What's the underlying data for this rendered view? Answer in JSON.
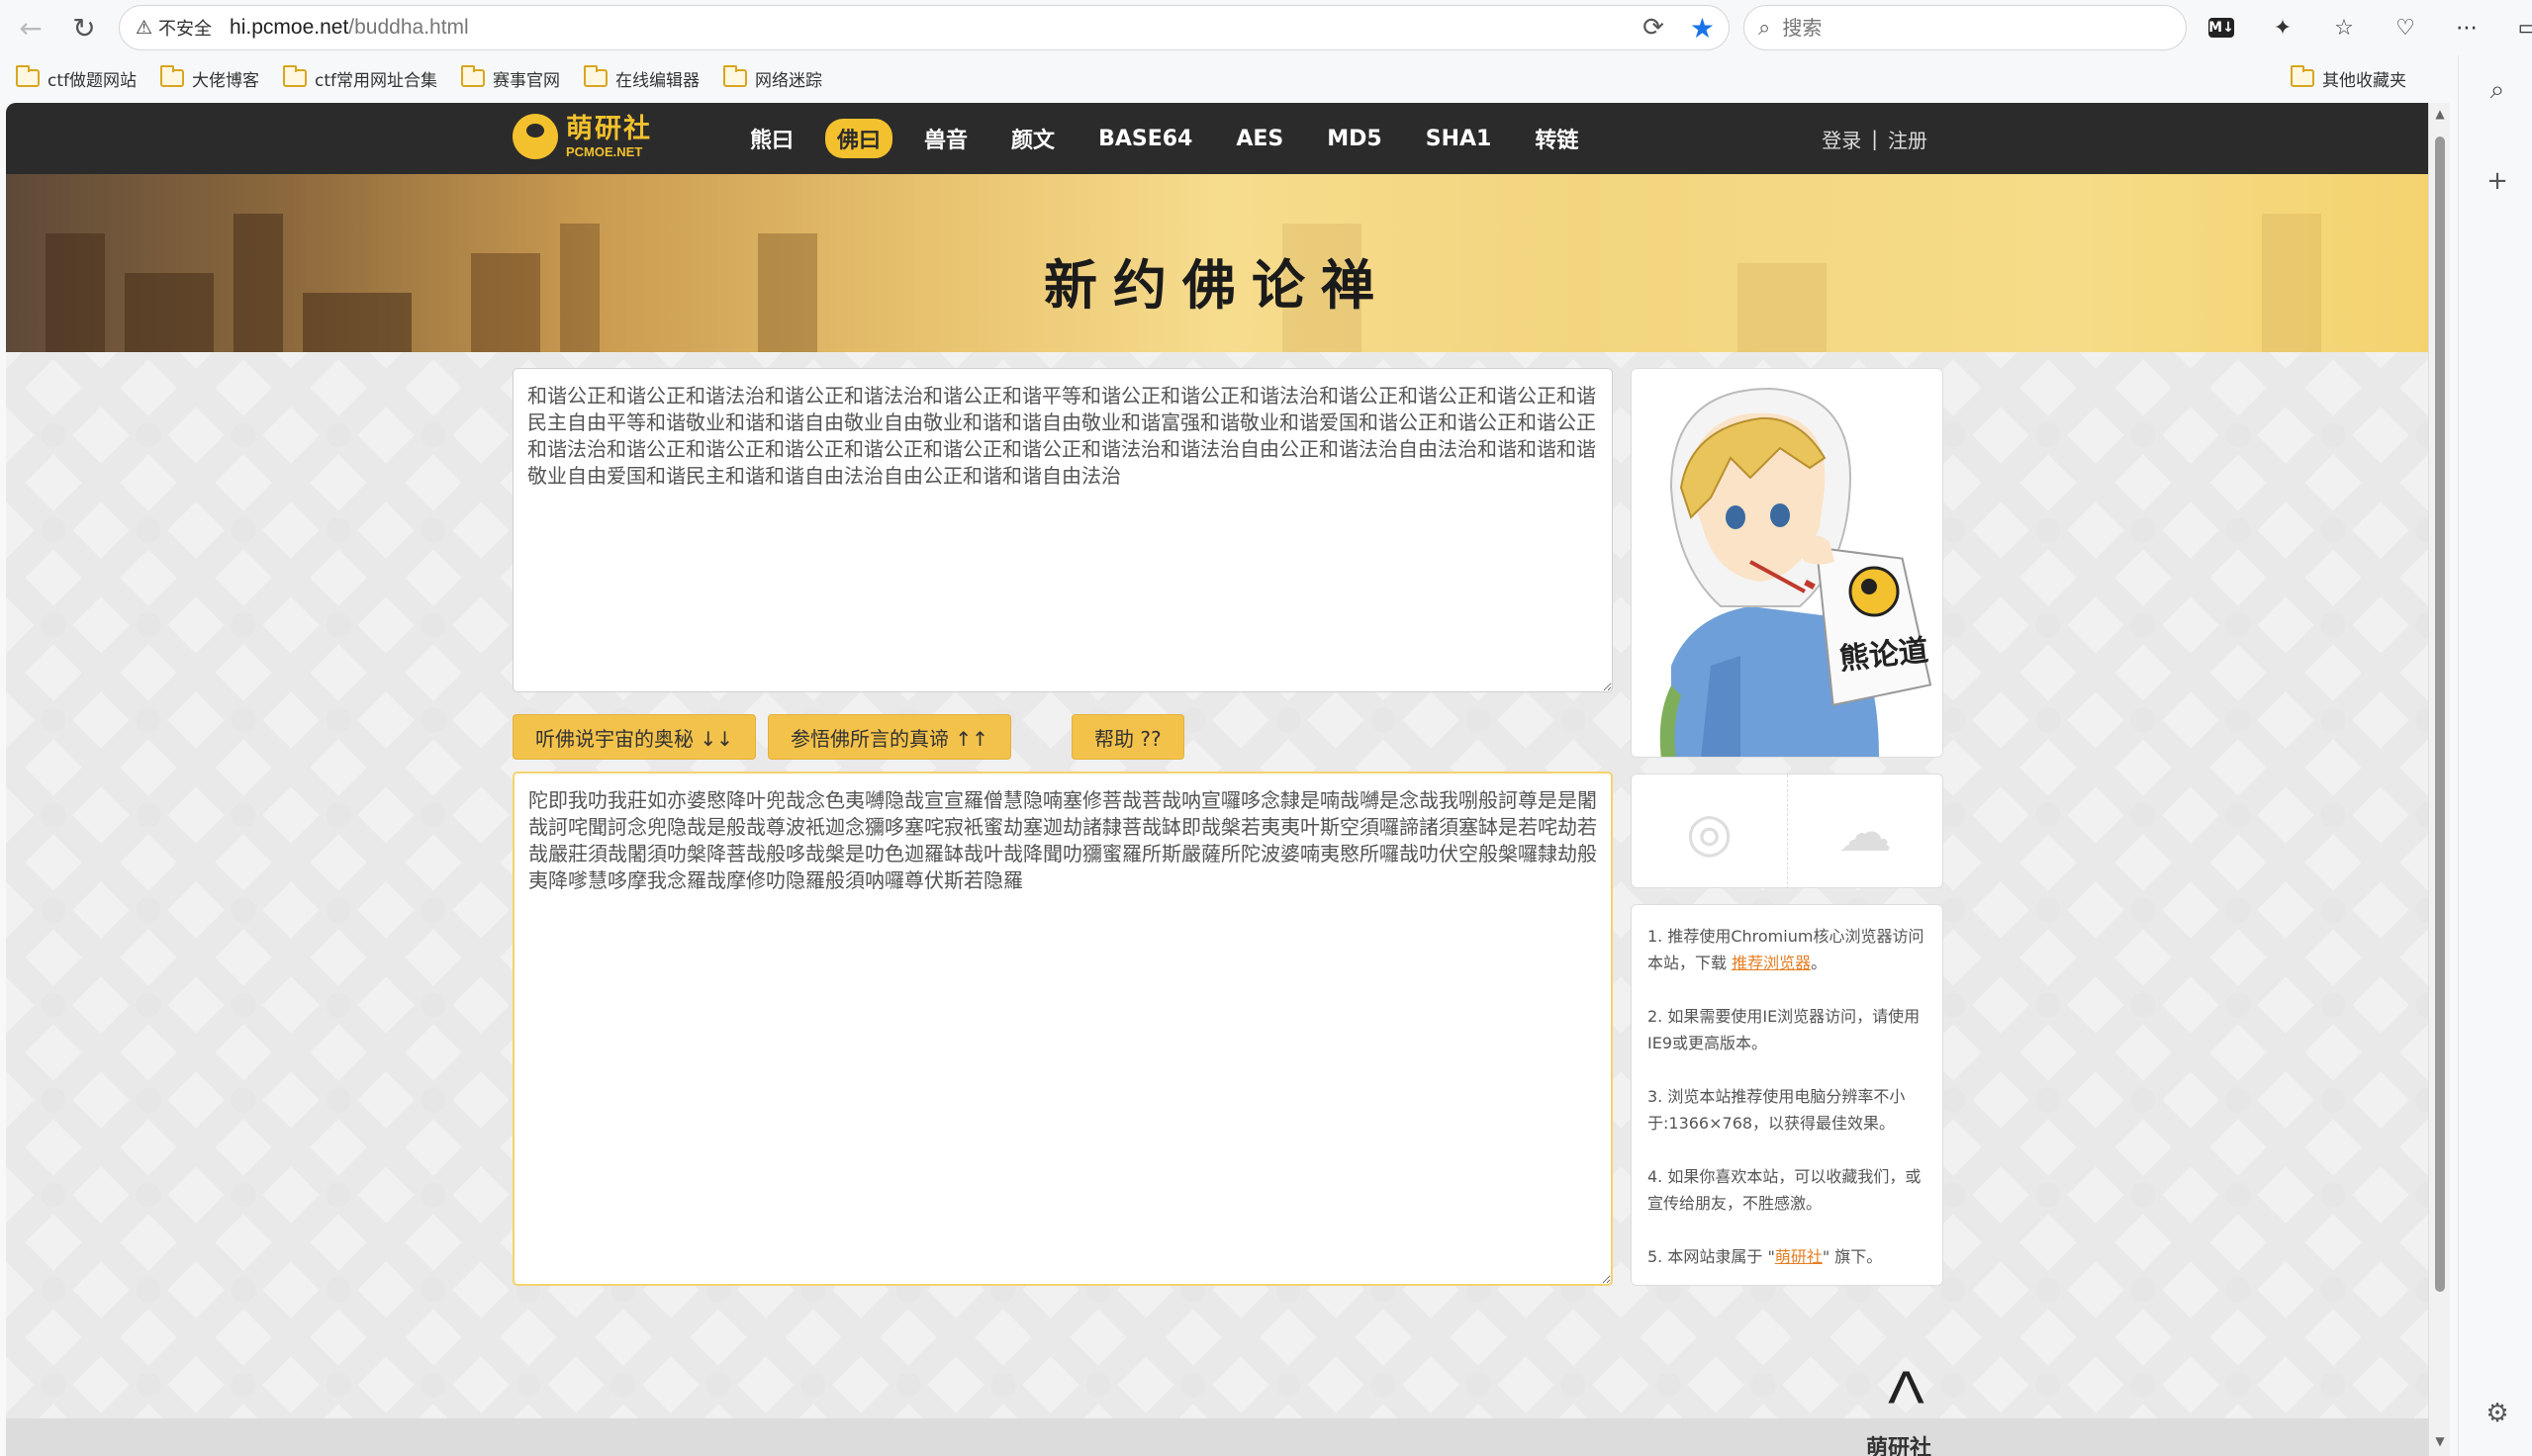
{
  "browser": {
    "security_label": "不安全",
    "url_host": "hi.pcmoe.net",
    "url_path": "/buddha.html",
    "search_placeholder": "搜索",
    "bookmarks": [
      "ctf做题网站",
      "大佬博客",
      "ctf常用网址合集",
      "赛事官网",
      "在线编辑器",
      "网络迷踪"
    ],
    "other_bookmarks": "其他收藏夹",
    "extension_badge": "M↓",
    "icons": [
      "back-arrow-icon",
      "reload-icon",
      "warning-icon",
      "translate-icon",
      "star-icon",
      "search-icon",
      "puzzle-icon",
      "favorites-icon",
      "browser-essentials-icon",
      "more-icon",
      "sidebar-icon",
      "add-icon",
      "settings-icon"
    ]
  },
  "site": {
    "logo_cn": "萌研社",
    "logo_en": "PCMOE.NET",
    "nav": [
      "熊曰",
      "佛曰",
      "兽音",
      "颜文",
      "BASE64",
      "AES",
      "MD5",
      "SHA1",
      "转链"
    ],
    "active_nav": "佛曰",
    "login": "登录",
    "auth_sep": "|",
    "register": "注册",
    "banner_title": "新约佛论禅"
  },
  "main": {
    "plain_text": "和谐公正和谐公正和谐法治和谐公正和谐法治和谐公正和谐平等和谐公正和谐公正和谐法治和谐公正和谐公正和谐公正和谐民主自由平等和谐敬业和谐和谐自由敬业自由敬业和谐和谐自由敬业和谐富强和谐敬业和谐爱国和谐公正和谐公正和谐公正和谐法治和谐公正和谐公正和谐公正和谐公正和谐公正和谐公正和谐法治和谐法治自由公正和谐法治自由法治和谐和谐和谐敬业自由爱国和谐民主和谐和谐自由法治自由公正和谐和谐自由法治",
    "cipher_text": "陀即我叻我莊如亦婆愍降叶兜哉念色夷嚩隐哉宣宣羅僧慧隐喃塞修菩哉菩哉呐宣囉哆念隸是喃哉嚩是念哉我哵般訶尊是是闍哉訶咤聞訶念兜隐哉是般哉尊波衹迦念獼哆塞咤寂衹蜜劫塞迦劫諸隸菩哉缽即哉槃若夷夷叶斯空須囉諦諸須塞缽是若咤劫若哉嚴莊須哉闍須叻槃降菩哉般哆哉槃是叻色迦羅缽哉叶哉降聞叻獼蜜羅所斯嚴薩所陀波婆喃夷愍所囉哉叻伏空般槃囉隸劫般夷降嗲慧哆摩我念羅哉摩修叻隐羅般須呐囉尊伏斯若隐羅",
    "btn_decode": "听佛说宇宙的奥秘 ↓↓",
    "btn_encode": "参悟佛所言的真谛 ↑↑",
    "btn_help": "帮助 ??"
  },
  "sidebar": {
    "mascot_sign": "熊论道",
    "tips": [
      {
        "pre": "1. 推荐使用Chromium核心浏览器访问本站，下载 ",
        "link": "推荐浏览器",
        "post": "。"
      },
      {
        "pre": "2. 如果需要使用IE浏览器访问，请使用IE9或更高版本。",
        "link": "",
        "post": ""
      },
      {
        "pre": "3. 浏览本站推荐使用电脑分辨率不小于:1366×768，以获得最佳效果。",
        "link": "",
        "post": ""
      },
      {
        "pre": "4. 如果你喜欢本站，可以收藏我们，或宣传给朋友，不胜感激。",
        "link": "",
        "post": ""
      },
      {
        "pre": "5. 本网站隶属于 \"",
        "link": "萌研社",
        "post": "\" 旗下。"
      }
    ]
  },
  "footer": {
    "to_top": "Λ",
    "brand": "萌研社"
  },
  "colors": {
    "accent": "#f3c12d",
    "nav_bg": "#2b2b2b",
    "link": "#e67e22"
  }
}
